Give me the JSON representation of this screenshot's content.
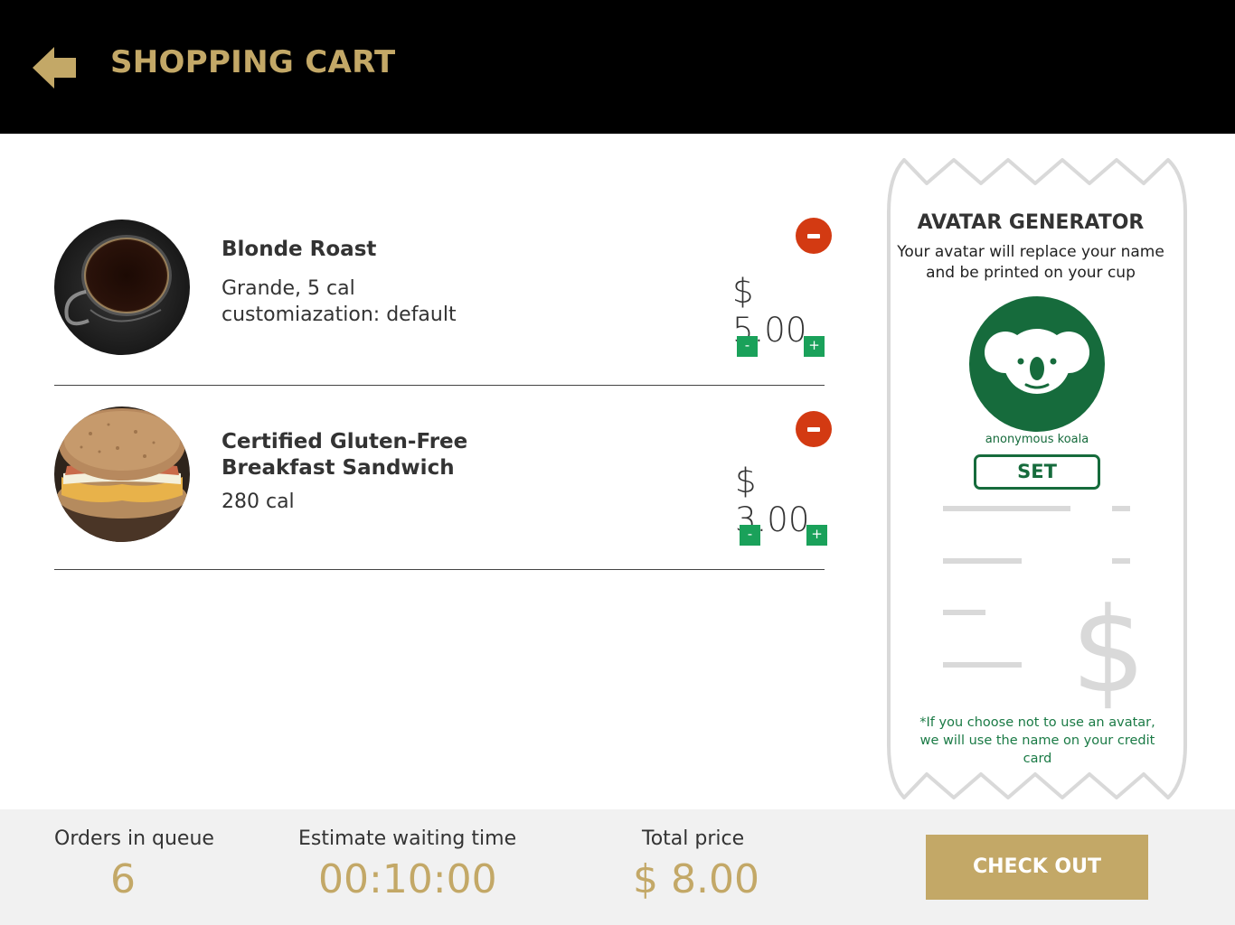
{
  "header": {
    "title": "SHOPPING CART"
  },
  "cart": {
    "items": [
      {
        "name_line1": "Blonde Roast",
        "detail_line1": "Grande, 5 cal",
        "detail_line2": "customiazation: default",
        "price": "$ 5.00",
        "minus": "-",
        "plus": "+"
      },
      {
        "name_line1": "Certified Gluten-Free",
        "name_line2": "Breakfast Sandwich",
        "detail_line1": "280 cal",
        "price": "$ 3.00",
        "minus": "-",
        "plus": "+"
      }
    ]
  },
  "avatar": {
    "title": "AVATAR GENERATOR",
    "description": "Your avatar will replace your name and be printed on your cup",
    "avatar_name": "anonymous koala",
    "set_label": "SET",
    "note": "*If you choose not to use an avatar, we will use the name on your credit card"
  },
  "footer": {
    "queue_label": "Orders in queue",
    "queue_value": "6",
    "wait_label": "Estimate waiting time",
    "wait_value": "00:10:00",
    "total_label": "Total price",
    "total_value": "$ 8.00",
    "checkout_label": "CHECK OUT"
  },
  "colors": {
    "gold": "#c3a867",
    "green": "#166b3c",
    "button_green": "#1aa15a",
    "remove_red": "#d33a12"
  }
}
